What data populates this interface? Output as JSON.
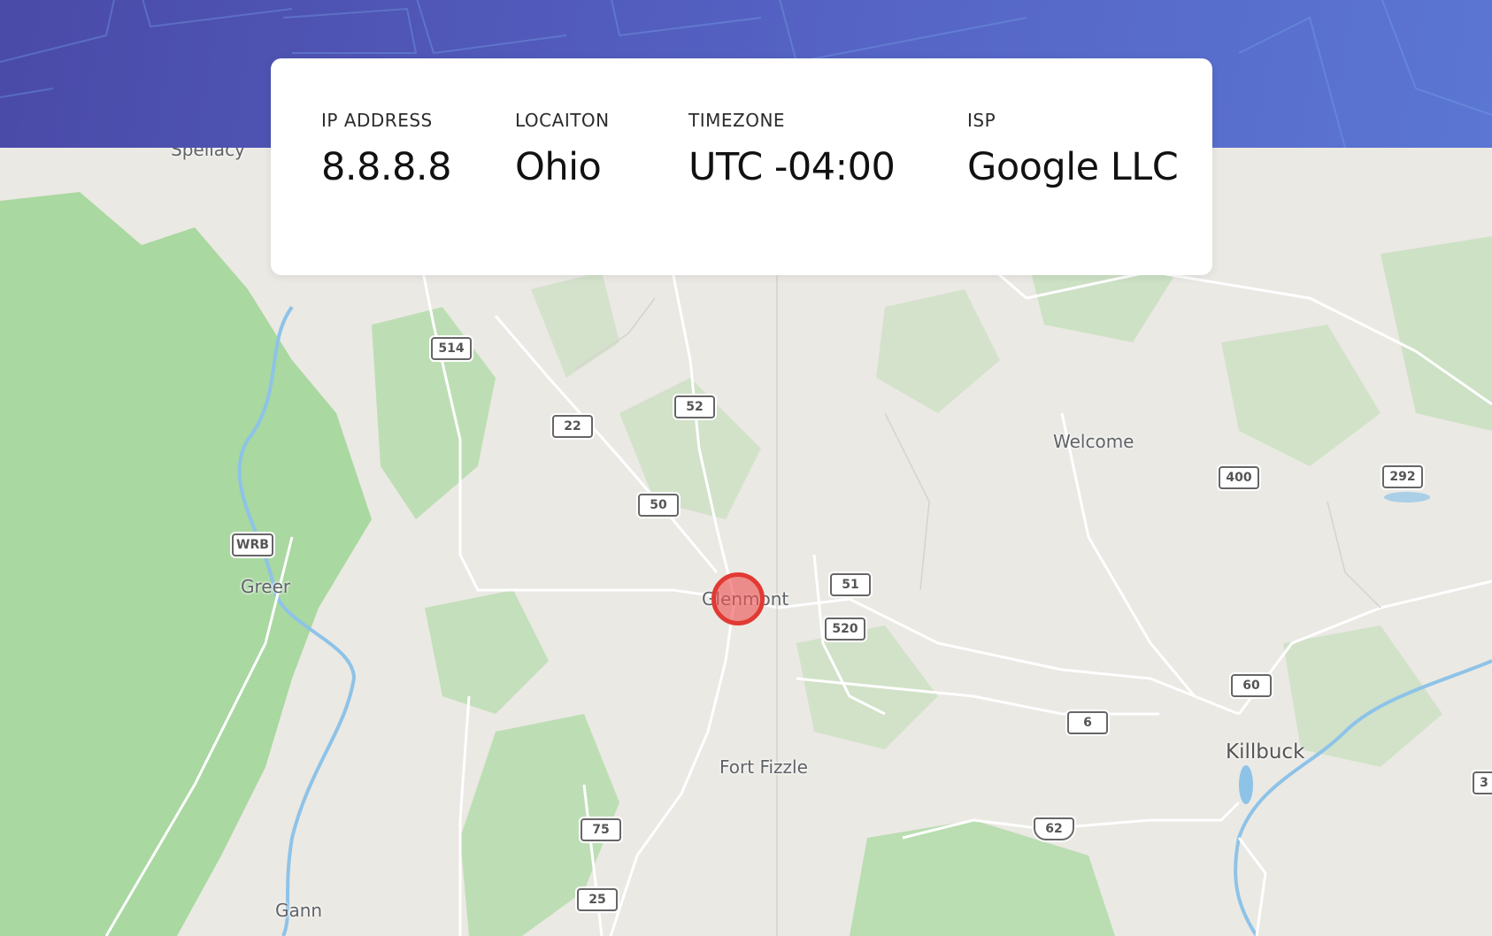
{
  "info": {
    "ip": {
      "label": "IP ADDRESS",
      "value": "8.8.8.8"
    },
    "location": {
      "label": "LOCAITON",
      "value": "Ohio"
    },
    "timezone": {
      "label": "TIMEZONE",
      "value": "UTC -04:00"
    },
    "isp": {
      "label": "ISP",
      "value": "Google LLC"
    }
  },
  "map": {
    "places": [
      "Spellacy",
      "Greer",
      "Glenmont",
      "Welcome",
      "Fort Fizzle",
      "Killbuck",
      "Gann"
    ],
    "routes": [
      "514",
      "52",
      "22",
      "50",
      "WRB",
      "51",
      "520",
      "400",
      "292",
      "60",
      "6",
      "62",
      "75",
      "25",
      "3"
    ],
    "marker_color": "#e13a33"
  },
  "colors": {
    "header_start": "#4a4aa8",
    "header_end": "#5b76d3",
    "map_land": "#ebe9e4",
    "map_forest": "#a8d8a0",
    "map_water": "#8ec3e8"
  }
}
